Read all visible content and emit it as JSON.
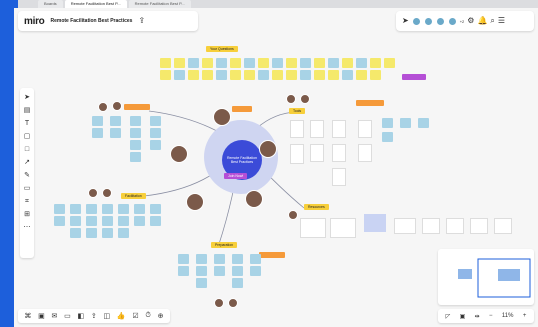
{
  "browser": {
    "tabs": [
      {
        "label": "Boards",
        "active": false
      },
      {
        "label": "Remote Facilitation Best P...",
        "active": true
      },
      {
        "label": "Remote Facilitation Best P...",
        "active": false
      }
    ]
  },
  "app": {
    "logo": "miro",
    "board_title": "Remote Facilitation Best Practices",
    "presence_count": "+2"
  },
  "board": {
    "top_section_label": "Your Questions",
    "hub_text": "Remote Facilitation Best Practices",
    "hub_button": "Join Now!",
    "labels": {
      "tools": "Tools",
      "facilitation": "Facilitation",
      "preparation": "Preparation",
      "resources": "Resources"
    },
    "zoom": "11%"
  },
  "colors": {
    "accent": "#1d5fdb",
    "sticky_yellow": "#f5e96b",
    "sticky_blue": "#a8d3e6",
    "hub": "#3b4bd8"
  }
}
